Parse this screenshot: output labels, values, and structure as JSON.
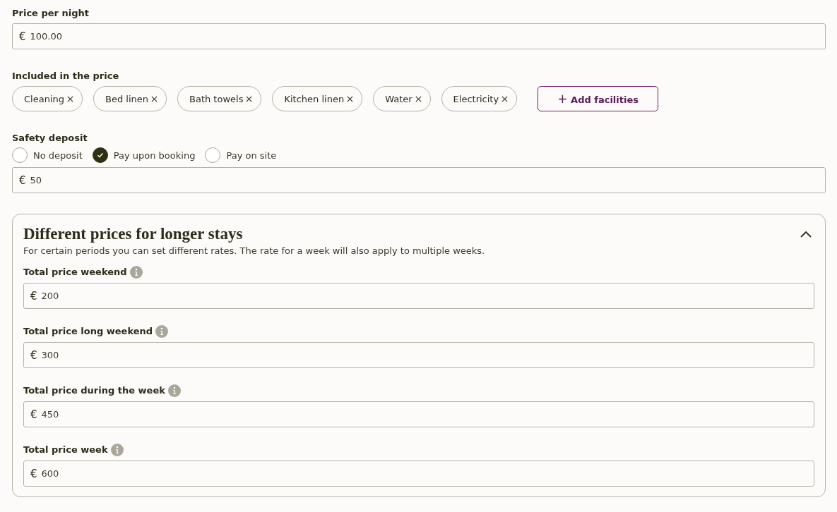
{
  "price_per_night": {
    "label": "Price per night",
    "currency": "€",
    "value": "100.00"
  },
  "included": {
    "label": "Included in the price",
    "chips": [
      {
        "label": "Cleaning"
      },
      {
        "label": "Bed linen"
      },
      {
        "label": "Bath towels"
      },
      {
        "label": "Kitchen linen"
      },
      {
        "label": "Water"
      },
      {
        "label": "Electricity"
      }
    ],
    "add_button": {
      "icon": "+",
      "label": "Add facilities"
    }
  },
  "safety_deposit": {
    "label": "Safety deposit",
    "options": [
      {
        "label": "No deposit",
        "selected": false
      },
      {
        "label": "Pay upon booking",
        "selected": true
      },
      {
        "label": "Pay on site",
        "selected": false
      }
    ],
    "currency": "€",
    "value": "50"
  },
  "longer_stays": {
    "title": "Different prices for longer stays",
    "expanded": true,
    "description": "For certain periods you can set different rates. The rate for a week will also apply to multiple weeks.",
    "fields": [
      {
        "label": "Total price weekend",
        "currency": "€",
        "value": "200"
      },
      {
        "label": "Total price long weekend",
        "currency": "€",
        "value": "300"
      },
      {
        "label": "Total price during the week",
        "currency": "€",
        "value": "450"
      },
      {
        "label": "Total price week",
        "currency": "€",
        "value": "600"
      }
    ]
  }
}
